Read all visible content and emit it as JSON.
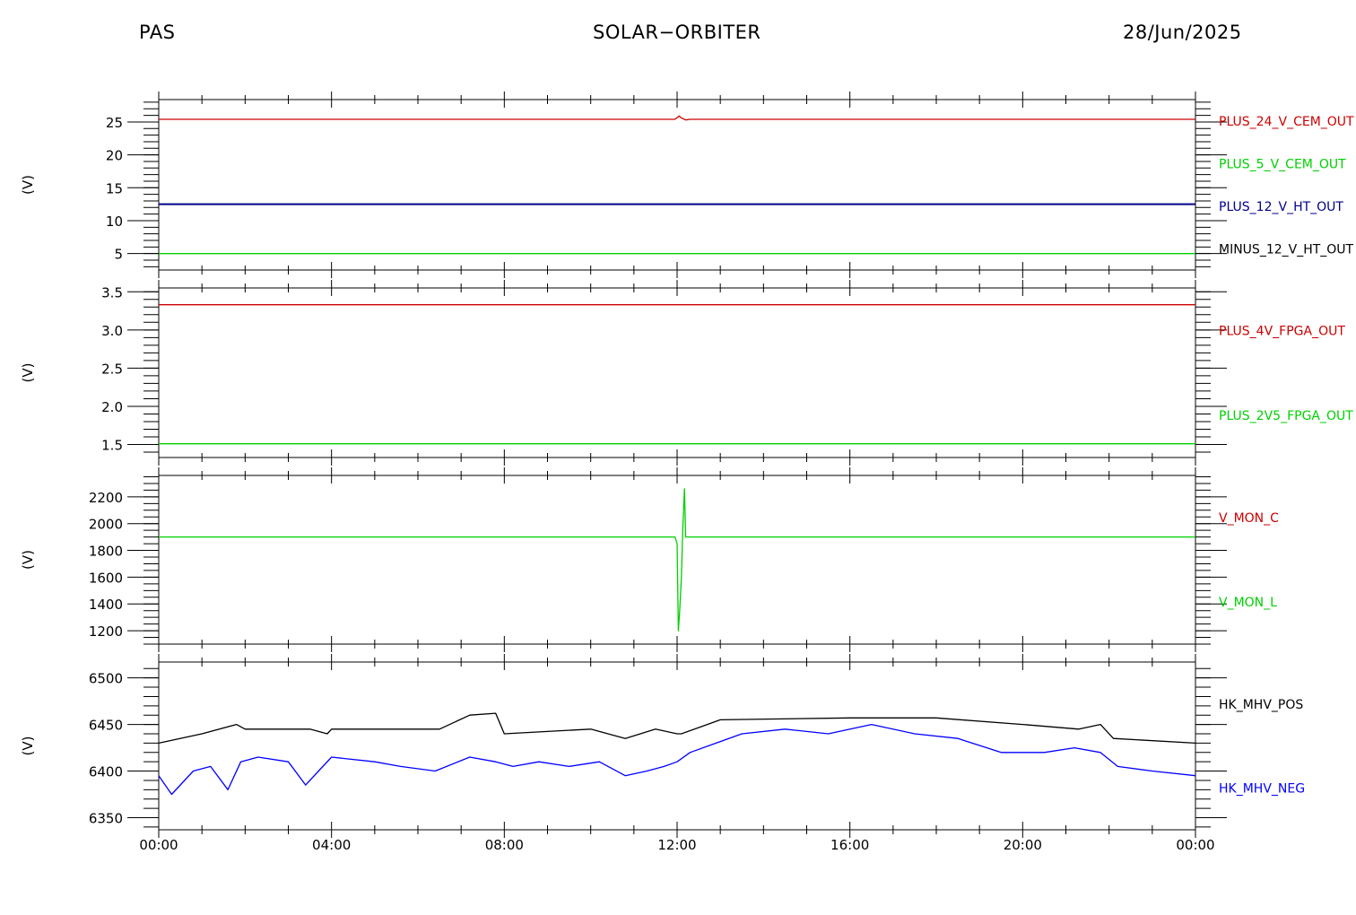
{
  "header": {
    "left": "PAS",
    "center": "SOLAR−ORBITER",
    "right": "28/Jun/2025"
  },
  "colors": {
    "red": "#cc0000",
    "green": "#00d000",
    "blue": "#0000ff",
    "navy": "#00008b",
    "black": "#000000"
  },
  "chart_data": [
    {
      "type": "line",
      "ylabel": "(V)",
      "ylim": [
        2.5,
        28.4
      ],
      "yticks": [
        5,
        10,
        15,
        20,
        25
      ],
      "ytick_labels": [
        "5",
        "10",
        "15",
        "20",
        "25"
      ],
      "minor_step": 1,
      "legend": [
        {
          "label": "PLUS_24_V_CEM_OUT",
          "color": "#cc0000"
        },
        {
          "label": "PLUS_5_V_CEM_OUT",
          "color": "#00d000"
        },
        {
          "label": "PLUS_12_V_HT_OUT",
          "color": "#00008b"
        },
        {
          "label": "MINUS_12_V_HT_OUT",
          "color": "#000000"
        }
      ],
      "series": [
        {
          "name": "PLUS_24_V_CEM_OUT",
          "color": "#cc0000",
          "x": [
            0,
            11.95,
            12.05,
            12.1,
            12.2,
            12.3,
            24
          ],
          "y": [
            25.4,
            25.4,
            25.9,
            25.6,
            25.3,
            25.4,
            25.4
          ]
        },
        {
          "name": "PLUS_5_V_CEM_OUT",
          "color": "#00d000",
          "x": [
            0,
            24
          ],
          "y": [
            5.0,
            5.0
          ]
        },
        {
          "name": "PLUS_12_V_HT_OUT",
          "color": "#00008b",
          "x": [
            0,
            24
          ],
          "y": [
            12.5,
            12.5
          ]
        }
      ]
    },
    {
      "type": "line",
      "ylabel": "(V)",
      "ylim": [
        1.33,
        3.55
      ],
      "yticks": [
        1.5,
        2.0,
        2.5,
        3.0,
        3.5
      ],
      "ytick_labels": [
        "1.5",
        "2.0",
        "2.5",
        "3.0",
        "3.5"
      ],
      "minor_step": 0.1,
      "legend": [
        {
          "label": "PLUS_4V_FPGA_OUT",
          "color": "#cc0000"
        },
        {
          "label": "PLUS_2V5_FPGA_OUT",
          "color": "#00d000"
        }
      ],
      "series": [
        {
          "name": "PLUS_4V_FPGA_OUT",
          "color": "#cc0000",
          "x": [
            0,
            24
          ],
          "y": [
            3.33,
            3.33
          ]
        },
        {
          "name": "PLUS_2V5_FPGA_OUT",
          "color": "#00d000",
          "x": [
            0,
            24
          ],
          "y": [
            1.51,
            1.51
          ]
        }
      ]
    },
    {
      "type": "line",
      "ylabel": "(V)",
      "ylim": [
        1100,
        2360
      ],
      "yticks": [
        1200,
        1400,
        1600,
        1800,
        2000,
        2200
      ],
      "ytick_labels": [
        "1200",
        "1400",
        "1600",
        "1800",
        "2000",
        "2200"
      ],
      "minor_step": 50,
      "legend": [
        {
          "label": "V_MON_C",
          "color": "#cc0000"
        },
        {
          "label": "V_MON_L",
          "color": "#00d000"
        }
      ],
      "series": [
        {
          "name": "V_MON_L",
          "color": "#00d000",
          "x": [
            0,
            11.95,
            12.0,
            12.03,
            12.06,
            12.1,
            12.13,
            12.17,
            12.2,
            12.25,
            24
          ],
          "y": [
            1900,
            1900,
            1850,
            1200,
            1350,
            1600,
            1950,
            2260,
            1900,
            1900,
            1900
          ]
        }
      ]
    },
    {
      "type": "line",
      "ylabel": "(V)",
      "ylim": [
        6337,
        6517
      ],
      "yticks": [
        6350,
        6400,
        6450,
        6500
      ],
      "ytick_labels": [
        "6350",
        "6400",
        "6450",
        "6500"
      ],
      "minor_step": 10,
      "legend": [
        {
          "label": "HK_MHV_POS",
          "color": "#000000"
        },
        {
          "label": "HK_MHV_NEG",
          "color": "#0000ff"
        }
      ],
      "series": [
        {
          "name": "HK_MHV_POS",
          "color": "#000000",
          "x": [
            0,
            1,
            1.8,
            2,
            3.5,
            3.9,
            4,
            6.5,
            7.2,
            7.8,
            8,
            10,
            10.8,
            11.5,
            12,
            12.1,
            12.7,
            13,
            16,
            18,
            20,
            21.3,
            21.8,
            22.1,
            24
          ],
          "y": [
            6430,
            6440,
            6450,
            6445,
            6445,
            6440,
            6445,
            6445,
            6460,
            6462,
            6440,
            6445,
            6435,
            6445,
            6440,
            6440,
            6450,
            6455,
            6457,
            6457,
            6450,
            6445,
            6450,
            6435,
            6430
          ]
        },
        {
          "name": "HK_MHV_NEG",
          "color": "#0000ff",
          "x": [
            0,
            0.3,
            0.8,
            1.2,
            1.6,
            1.9,
            2.3,
            3,
            3.4,
            3.7,
            4,
            5,
            5.6,
            6.4,
            7.2,
            7.8,
            8.2,
            8.8,
            9.5,
            10.2,
            10.8,
            11.3,
            11.7,
            12,
            12.3,
            12.9,
            13.5,
            14.5,
            15.5,
            16.5,
            17.5,
            18.5,
            19.5,
            20.5,
            21.2,
            21.8,
            22.2,
            23,
            24
          ],
          "y": [
            6395,
            6375,
            6400,
            6405,
            6380,
            6410,
            6415,
            6410,
            6385,
            6400,
            6415,
            6410,
            6405,
            6400,
            6415,
            6410,
            6405,
            6410,
            6405,
            6410,
            6395,
            6400,
            6405,
            6410,
            6420,
            6430,
            6440,
            6445,
            6440,
            6450,
            6440,
            6435,
            6420,
            6420,
            6425,
            6420,
            6405,
            6400,
            6395
          ]
        }
      ]
    }
  ],
  "xaxis": {
    "xlim": [
      0,
      24
    ],
    "ticks": [
      0,
      4,
      8,
      12,
      16,
      20,
      24
    ],
    "tick_labels": [
      "00:00",
      "04:00",
      "08:00",
      "12:00",
      "16:00",
      "20:00",
      "00:00"
    ],
    "minor_step": 1
  }
}
